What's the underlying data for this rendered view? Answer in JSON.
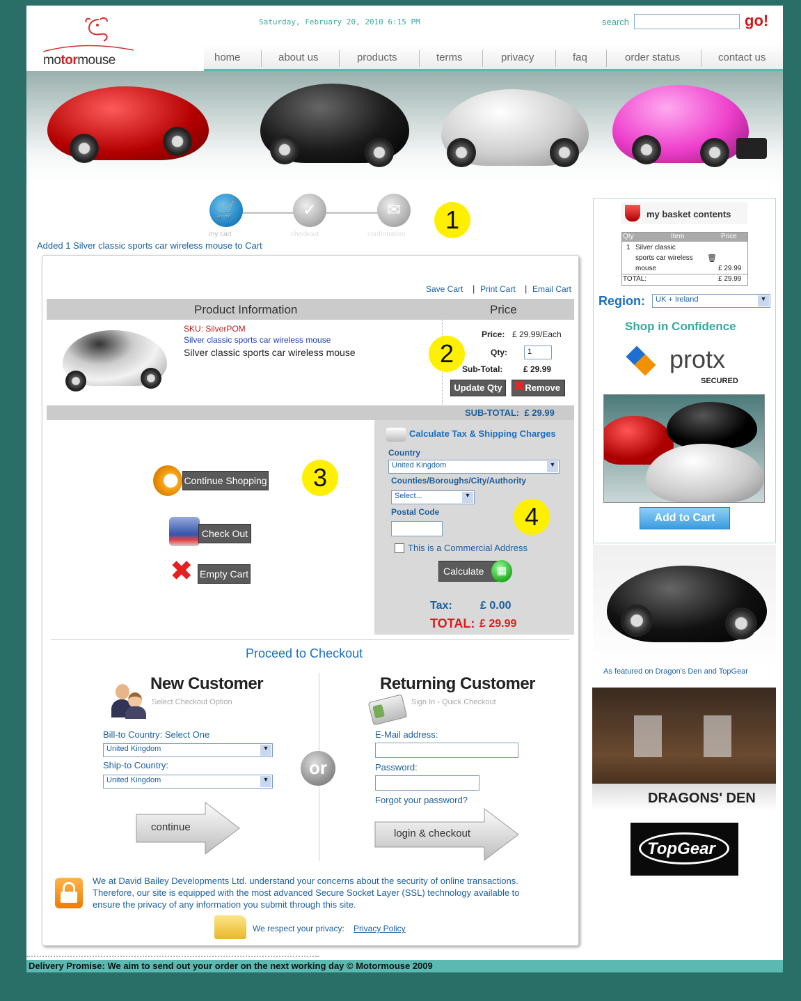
{
  "header": {
    "date": "Saturday, February 20, 2010 6:15 PM",
    "search_label": "search",
    "search_value": "",
    "go_label": "go!",
    "logo_pre": "mo",
    "logo_bold": "tor",
    "logo_post": "mouse"
  },
  "nav": [
    "home",
    "about us",
    "products",
    "terms",
    "privacy",
    "faq",
    "order status",
    "contact us"
  ],
  "progress": {
    "steps": [
      "my cart",
      "checkout",
      "confirmation"
    ],
    "added_message": "Added 1 Silver classic sports car wireless mouse to Cart",
    "marker1": "1",
    "marker2": "2",
    "marker3": "3",
    "marker4": "4"
  },
  "cart": {
    "links": [
      "Save Cart",
      "Print Cart",
      "Email Cart"
    ],
    "sep": "|",
    "header_product": "Product Information",
    "header_price": "Price",
    "item": {
      "sku": "SKU: SilverPOM",
      "link": "Silver classic sports car wireless mouse",
      "desc": "Silver classic sports car wireless mouse",
      "price_label": "Price:",
      "price_value": "£ 29.99/Each",
      "qty_label": "Qty:",
      "qty_value": "1",
      "subtotal_label": "Sub-Total:",
      "subtotal_value": "£ 29.99"
    },
    "update_label": "Update Qty",
    "remove_label": "Remove",
    "subtotal_bar": "SUB-TOTAL:  £ 29.99"
  },
  "actions": {
    "continue_shopping": "Continue Shopping",
    "checkout": "Check Out",
    "empty_cart": "Empty Cart"
  },
  "tax": {
    "title": "Calculate Tax & Shipping Charges",
    "country_label": "Country",
    "country_value": "United Kingdom",
    "counties_label": "Counties/Boroughs/City/Authority",
    "counties_value": "Select...",
    "postal_label": "Postal Code",
    "postal_value": "",
    "commercial_label": "This is a Commercial Address",
    "calculate_label": "Calculate",
    "tax_label": "Tax:",
    "tax_value": "£ 0.00",
    "total_label": "TOTAL:",
    "total_value": "£ 29.99"
  },
  "proceed": {
    "title": "Proceed to Checkout",
    "or": "or",
    "new": {
      "title": "New Customer",
      "subtitle": "Select Checkout Option",
      "bill_label": "Bill-to Country:",
      "bill_hint": "Select One",
      "bill_value": "United Kingdom",
      "ship_label": "Ship-to Country:",
      "ship_value": "United Kingdom",
      "continue_label": "continue"
    },
    "returning": {
      "title": "Returning Customer",
      "subtitle": "Sign In - Quick Checkout",
      "email_label": "E-Mail address:",
      "password_label": "Password:",
      "forgot": "Forgot your password?",
      "login_label": "login & checkout"
    }
  },
  "security": {
    "text1": "We at David Bailey Developments Ltd. understand your concerns about the security of online transactions.",
    "text2": "Therefore, our site is equipped with the most advanced Secure Socket Layer (SSL) technology available to",
    "text3": "ensure the privacy of any information you submit through this site.",
    "privacy_text": "We respect your privacy:",
    "privacy_link": "Privacy Policy"
  },
  "sidebar": {
    "basket_title": "my basket contents",
    "col_qty": "Qty",
    "col_item": "Item",
    "col_price": "Price",
    "row_qty": "1",
    "row_item1": "Silver classic",
    "row_item2": "sports car wireless",
    "row_item3": "mouse",
    "row_price": "£ 29.99",
    "total_label": "TOTAL:",
    "total_value": "£ 29.99",
    "region_label": "Region:",
    "region_value": "UK + Ireland",
    "confidence": "Shop in Confidence",
    "protx": "protx",
    "protx_secured": "SECURED",
    "add_to_cart": "Add to Cart",
    "featured": "As featured on Dragon's Den and TopGear",
    "dragons": "DRAGONS' DEN",
    "topgear": "TopGear"
  },
  "footer": {
    "text": "Delivery Promise: We aim to send out your order on the next working day  © Motormouse 2009"
  }
}
